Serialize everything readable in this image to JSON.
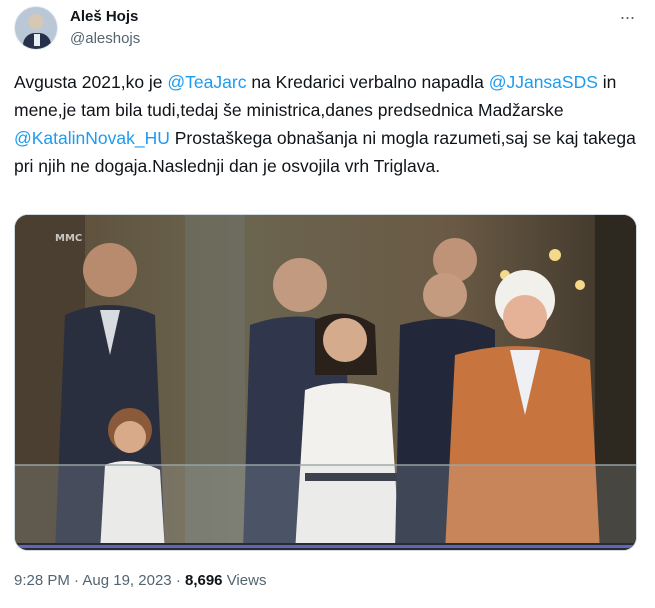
{
  "author": {
    "name": "Aleš Hojs",
    "handle": "@aleshojs"
  },
  "menu_icon": "more-horizontal-icon",
  "tweet": {
    "segments": [
      {
        "text": "Avgusta 2021,ko je ",
        "mention": false
      },
      {
        "text": "@TeaJarc",
        "mention": true
      },
      {
        "text": " na Kredarici verbalno napadla ",
        "mention": false
      },
      {
        "text": "@JJansaSDS",
        "mention": true
      },
      {
        "text": " in mene,je tam bila tudi,tedaj še ministrica,danes predsednica Madžarske ",
        "mention": false
      },
      {
        "text": "@KatalinNovak_HU",
        "mention": true
      },
      {
        "text": " Prostaškega obnašanja ni mogla razumeti,saj se kaj takega pri njih ne dogaja.Naslednji dan je osvojila vrh Triglava.",
        "mention": false
      }
    ]
  },
  "media": {
    "watermark": "MMC"
  },
  "meta": {
    "time": "9:28 PM",
    "sep": "·",
    "date": "Aug 19, 2023",
    "views_count": "8,696",
    "views_label": "Views"
  },
  "colors": {
    "link": "#1d9bf0",
    "secondary_text": "#536471",
    "primary_text": "#0f1419"
  }
}
